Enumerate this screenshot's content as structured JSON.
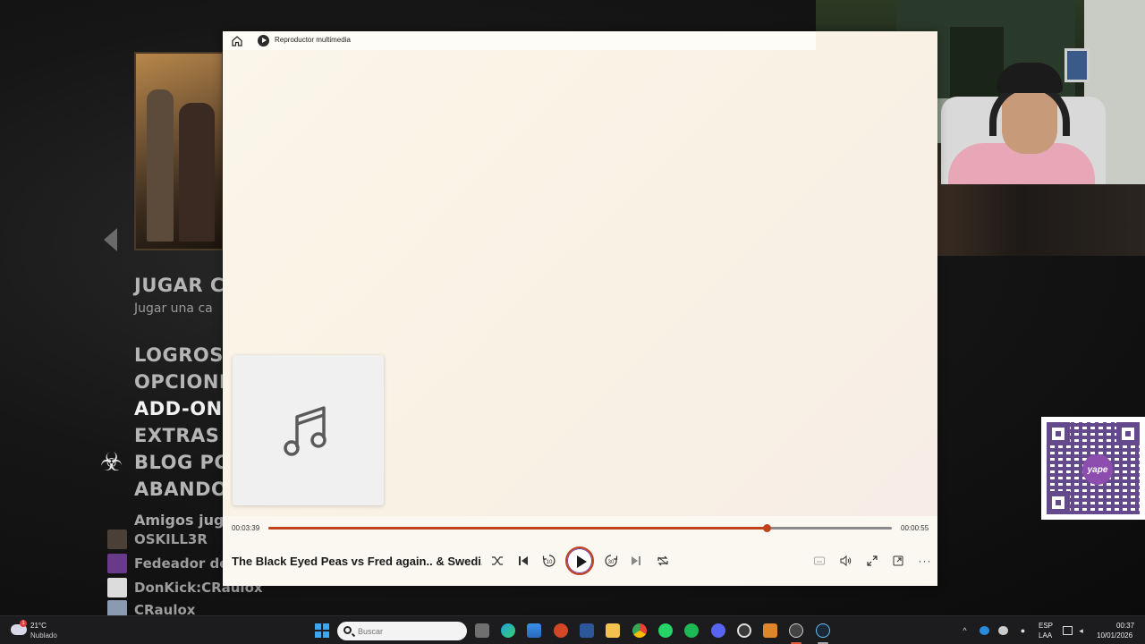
{
  "game_menu": {
    "items": [
      "JUGAR C",
      "LOGROS",
      "OPCIONE",
      "ADD-ONS",
      "EXTRAS",
      "BLOG PC",
      "ABANDO"
    ],
    "subtitle": "Jugar una ca",
    "friends_title": "Amigos jug",
    "friends": [
      "OSKILL3R",
      "Fedeador de",
      "DonKick:CRaulox",
      "CRaulox"
    ]
  },
  "player": {
    "app_title": "Reproductor multimedia",
    "current_time": "00:03:39",
    "remaining_time": "00:00:55",
    "progress": 0.7988,
    "song_title": "The Black Eyed Peas vs Fred again.. & Swedi...",
    "skip_back_seconds": "10",
    "skip_forward_seconds": "30",
    "colors": {
      "accent": "#c0421d"
    }
  },
  "qr": {
    "logo_text": "yape"
  },
  "taskbar": {
    "weather": {
      "temp": "21°C",
      "desc": "Nublado",
      "badge": "1"
    },
    "search_placeholder": "Buscar",
    "apps": [
      "file-explorer-icon",
      "edge-icon",
      "store-icon",
      "powerpoint-icon",
      "word-icon",
      "folder-icon",
      "chrome-icon",
      "whatsapp-icon",
      "spotify-icon",
      "discord-icon",
      "obs-icon",
      "left4dead-icon",
      "media-player-icon",
      "steam-icon"
    ],
    "lang_top": "ESP",
    "lang_bottom": "LAA",
    "time": "00:37",
    "date": "10/01/2026"
  }
}
